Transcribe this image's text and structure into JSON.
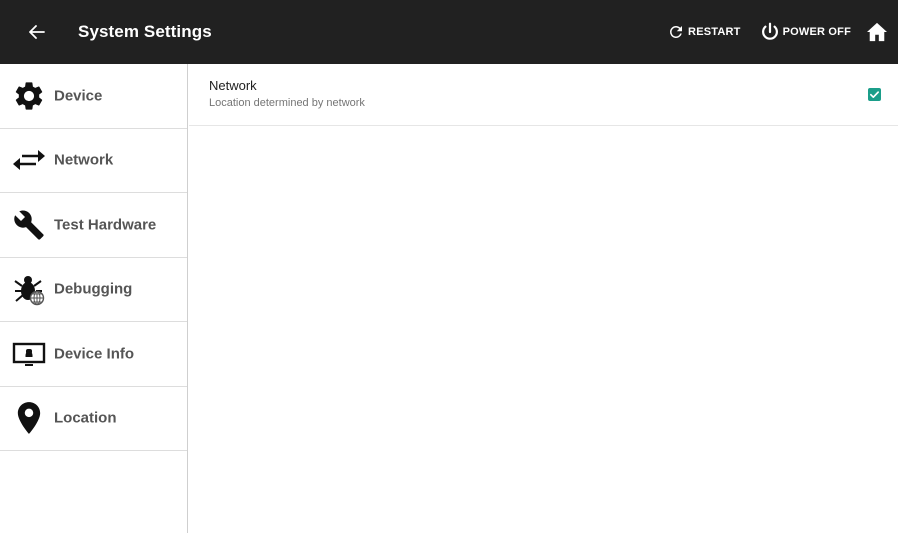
{
  "header": {
    "title": "System Settings",
    "back_icon": "arrow-left-icon",
    "restart_label": "RESTART",
    "power_off_label": "POWER OFF",
    "home_icon": "home-icon"
  },
  "sidebar": {
    "items": [
      {
        "label": "Device",
        "icon": "gear-icon"
      },
      {
        "label": "Network",
        "icon": "swap-arrows-icon"
      },
      {
        "label": "Test Hardware",
        "icon": "wrench-icon"
      },
      {
        "label": "Debugging",
        "icon": "bug-icon"
      },
      {
        "label": "Device Info",
        "icon": "monitor-icon"
      },
      {
        "label": "Location",
        "icon": "map-pin-icon"
      }
    ]
  },
  "content": {
    "settings": [
      {
        "title": "Network",
        "summary": "Location determined by network",
        "checked": true
      }
    ]
  },
  "colors": {
    "appbar": "#212121",
    "accent": "#1b9e8a",
    "nav_text": "#555555"
  }
}
